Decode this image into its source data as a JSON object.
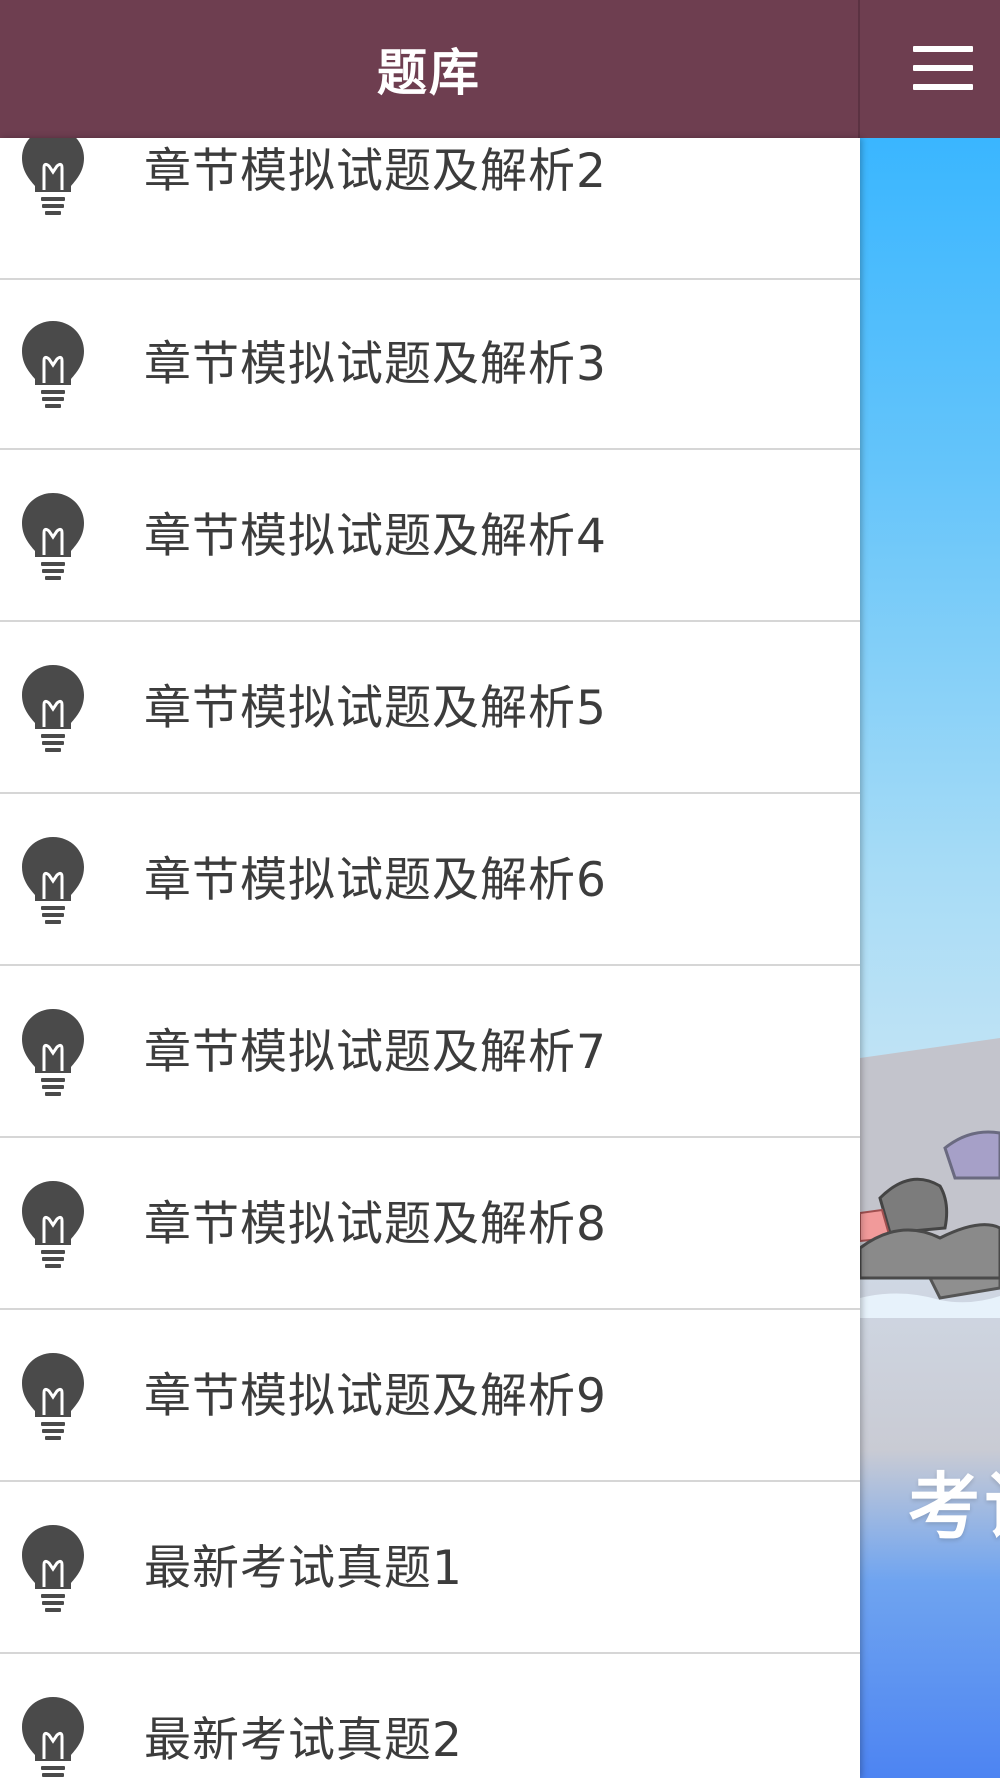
{
  "header": {
    "title": "题库",
    "menu_icon": "hamburger-menu-icon"
  },
  "side_panel": {
    "text": "考试"
  },
  "list": {
    "icon": "lightbulb-icon",
    "items": [
      {
        "label": "章节模拟试题及解析2"
      },
      {
        "label": "章节模拟试题及解析3"
      },
      {
        "label": "章节模拟试题及解析4"
      },
      {
        "label": "章节模拟试题及解析5"
      },
      {
        "label": "章节模拟试题及解析6"
      },
      {
        "label": "章节模拟试题及解析7"
      },
      {
        "label": "章节模拟试题及解析8"
      },
      {
        "label": "章节模拟试题及解析9"
      },
      {
        "label": "最新考试真题1"
      },
      {
        "label": "最新考试真题2"
      }
    ]
  },
  "colors": {
    "header_bg": "#6e3e50",
    "header_text": "#ffffff",
    "item_text": "#3c3c3c",
    "icon": "#4a4a4a"
  }
}
